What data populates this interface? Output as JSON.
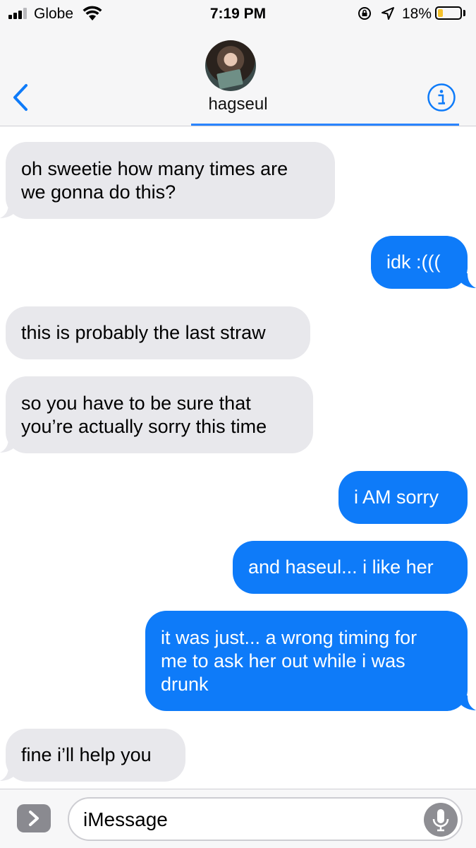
{
  "status_bar": {
    "carrier": "Globe",
    "time": "7:19 PM",
    "battery_percent": "18%",
    "battery_level": 0.18,
    "battery_color": "#f5c12a"
  },
  "header": {
    "contact_name": "hagseul",
    "back_icon": "chevron-left-icon",
    "info_icon": "info-icon",
    "accent": "#0e7bf9"
  },
  "messages": [
    {
      "side": "received",
      "text": "oh sweetie how many times are\nwe gonna do this?"
    },
    {
      "side": "sent",
      "text": "idk :((("
    },
    {
      "side": "received",
      "text": "this is probably the last straw"
    },
    {
      "side": "received",
      "text": "so you have to be sure that\nyou’re actually sorry this time"
    },
    {
      "side": "sent",
      "text": "i AM sorry"
    },
    {
      "side": "sent",
      "text": "and haseul... i like her"
    },
    {
      "side": "sent",
      "text": "it was just... a wrong timing for\nme to ask her out while i was\ndrunk"
    },
    {
      "side": "received",
      "text": "fine i’ll help you"
    }
  ],
  "input_bar": {
    "placeholder": "iMessage",
    "apps_icon": "chevron-right-icon",
    "mic_icon": "microphone-icon"
  }
}
